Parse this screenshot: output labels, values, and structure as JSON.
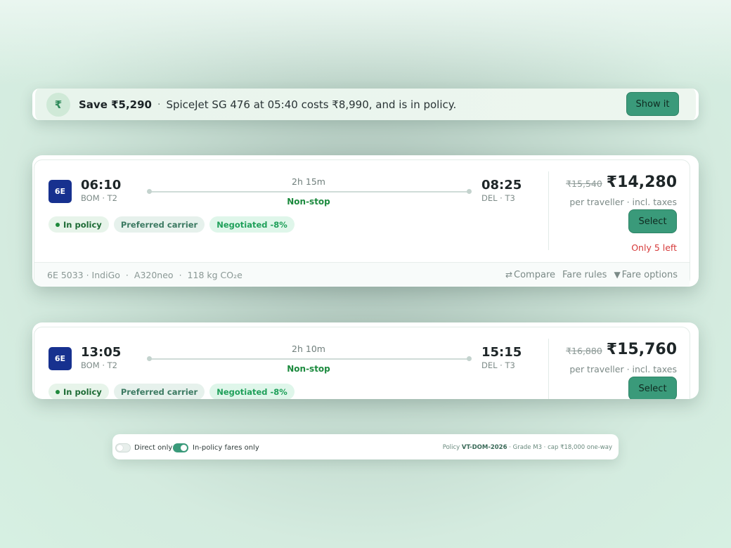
{
  "banner": {
    "icon": "rupee-icon",
    "icon_glyph": "₹",
    "save_text": "Save ₹5,290",
    "separator": "·",
    "message": "SpiceJet SG 476 at 05:40 costs ₹8,990, and is in policy.",
    "button_label": "Show it"
  },
  "flights": [
    {
      "airline_code": "6E",
      "dep_time": "06:10",
      "dep_airport": "BOM · T2",
      "arr_time": "08:25",
      "arr_airport": "DEL · T3",
      "duration": "2h 15m",
      "stops": "Non-stop",
      "chips": {
        "policy": "In policy",
        "preferred": "Preferred carrier",
        "negotiated": "Negotiated -8%"
      },
      "old_price": "₹15,540",
      "price": "₹14,280",
      "price_note": "per traveller · incl. taxes",
      "select_label": "Select",
      "seats_left": "Only 5 left",
      "footer": {
        "flight": "6E 5033 · IndiGo",
        "aircraft": "A320neo",
        "co2": "118 kg CO₂e",
        "sep": "·",
        "compare": "Compare",
        "fare_rules": "Fare rules",
        "fare_options": "Fare options"
      }
    },
    {
      "airline_code": "6E",
      "dep_time": "13:05",
      "dep_airport": "BOM · T2",
      "arr_time": "15:15",
      "arr_airport": "DEL · T3",
      "duration": "2h 10m",
      "stops": "Non-stop",
      "chips": {
        "policy": "In policy",
        "preferred": "Preferred carrier",
        "negotiated": "Negotiated -8%"
      },
      "old_price": "₹16,880",
      "price": "₹15,760",
      "price_note": "per traveller · incl. taxes",
      "select_label": "Select"
    }
  ],
  "filters": {
    "direct_only": {
      "label": "Direct only",
      "on": false
    },
    "in_policy_only": {
      "label": "In-policy fares only",
      "on": true
    },
    "policy_prefix": "Policy",
    "policy_id": "VT-DOM-2026",
    "policy_detail": "· Grade M3 · cap ₹18,000 one-way"
  },
  "colors": {
    "accent": "#3a9a7a",
    "airline_logo": "#17318f",
    "in_policy": "#1d6b35",
    "negotiated": "#1fa05a",
    "warning": "#d63a3a"
  }
}
